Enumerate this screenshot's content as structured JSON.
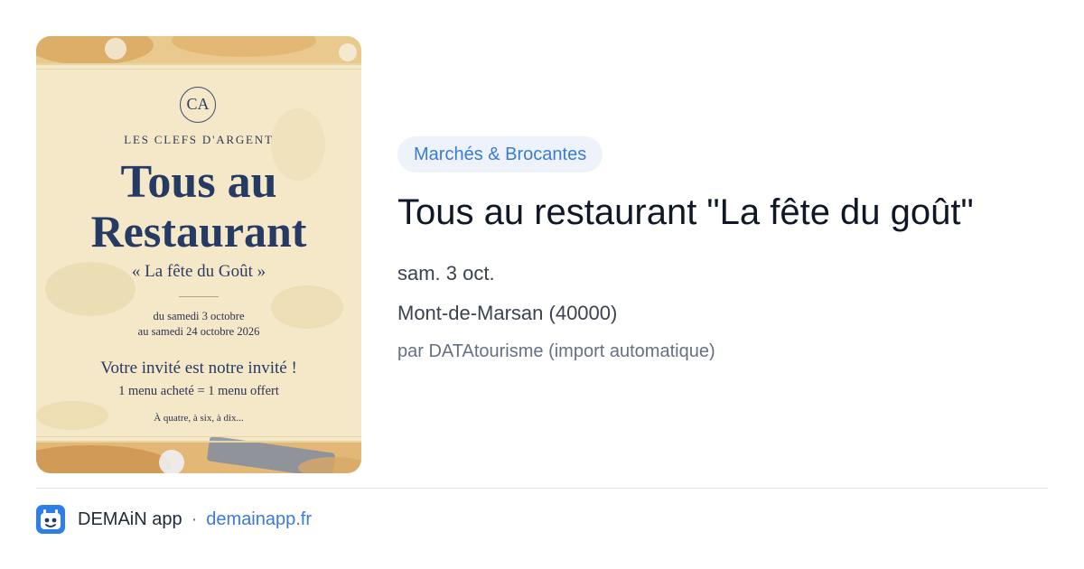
{
  "poster": {
    "brand": "LES CLEFS D'ARGENT",
    "monogram": "CA",
    "headline_line1": "Tous au",
    "headline_line2": "Restaurant",
    "subtitle": "« La fête du Goût »",
    "dates_line1": "du samedi 3 octobre",
    "dates_line2": "au samedi 24 octobre 2026",
    "invite": "Votre invité est notre invité !",
    "offer": "1 menu acheté = 1 menu offert",
    "tagline": "À quatre, à six, à dix..."
  },
  "event": {
    "category": "Marchés & Brocantes",
    "title": "Tous au restaurant \"La fête du goût\"",
    "date": "sam. 3 oct.",
    "location": "Mont-de-Marsan (40000)",
    "source": "par DATAtourisme (import automatique)"
  },
  "footer": {
    "app_name": "DEMAiN app",
    "separator": "·",
    "domain": "demainapp.fr",
    "app_icon": "demain-app-icon"
  },
  "colors": {
    "accent": "#3a7bd5",
    "pill_bg": "#eef3fb",
    "poster_ink": "#263b63",
    "poster_bg": "#f3e6c3"
  }
}
